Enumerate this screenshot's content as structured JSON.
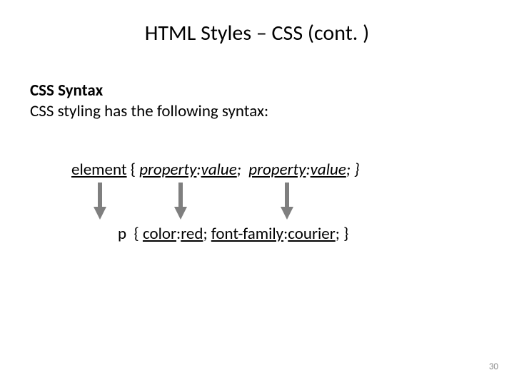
{
  "title": "HTML Styles – CSS (cont. )",
  "heading": "CSS Syntax",
  "intro": "CSS styling has the following syntax:",
  "syntax": {
    "element_label": "element",
    "open": "{",
    "prop1": "property",
    "colon1": ":",
    "val1": "value",
    "semi1": ";",
    "prop2": "property",
    "colon2": ":",
    "val2": "value",
    "semi2": ";",
    "close": "}"
  },
  "example": {
    "element": "p",
    "open": "{",
    "decl1_prop": "color",
    "decl1_colon": ":",
    "decl1_val": "red",
    "decl1_semi": ";",
    "decl2_prop": "font-family",
    "decl2_colon": ":",
    "decl2_val": "courier",
    "decl2_semi": ";",
    "close": "}"
  },
  "arrows": {
    "fill": "#7f7f7f",
    "stroke": "#5a5a5a"
  },
  "page_number": "30"
}
